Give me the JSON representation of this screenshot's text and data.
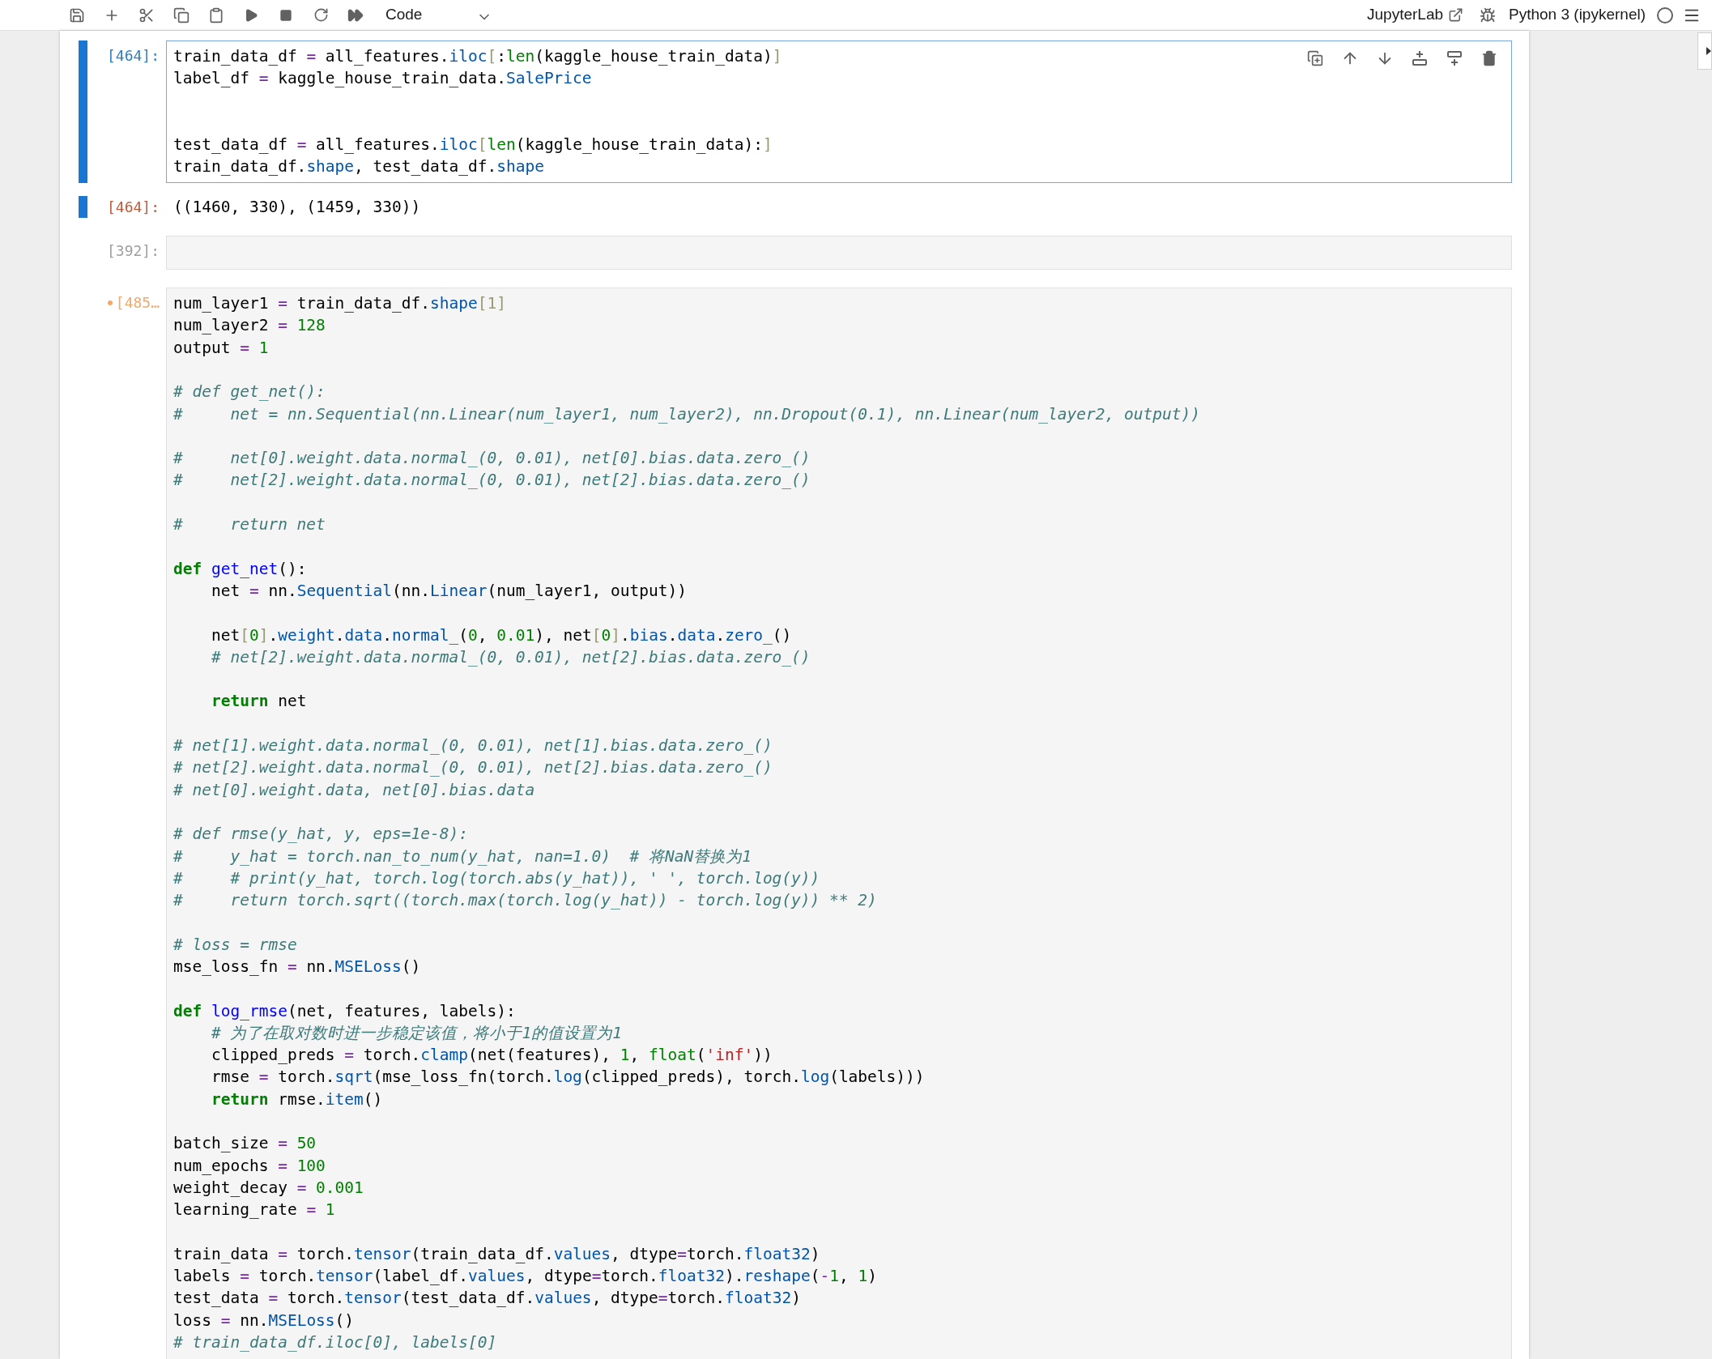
{
  "toolbar": {
    "cell_type": "Code",
    "jupyterlab_link": "JupyterLab",
    "kernel": "Python 3 (ipykernel)",
    "kernel_busy": false
  },
  "cells": [
    {
      "prompt": "[464]:",
      "selected": true,
      "dirty": false,
      "lines": [
        {
          "kind": "code",
          "segments": [
            {
              "kind": "name",
              "text": "train_data_df "
            },
            {
              "kind": "op",
              "text": "="
            },
            {
              "kind": "name",
              "text": " all_features."
            },
            {
              "kind": "attr",
              "text": "iloc"
            },
            {
              "kind": "bracket",
              "text": "["
            },
            {
              "kind": "name",
              "text": ":"
            },
            {
              "kind": "builtin",
              "text": "len"
            },
            {
              "kind": "name",
              "text": "(kaggle_house_train_data)"
            },
            {
              "kind": "bracket",
              "text": "]"
            }
          ]
        },
        {
          "kind": "code",
          "segments": [
            {
              "kind": "name",
              "text": "label_df "
            },
            {
              "kind": "op",
              "text": "="
            },
            {
              "kind": "name",
              "text": " kaggle_house_train_data."
            },
            {
              "kind": "attr",
              "text": "SalePrice"
            }
          ]
        },
        {
          "kind": "blank"
        },
        {
          "kind": "blank"
        },
        {
          "kind": "code",
          "segments": [
            {
              "kind": "name",
              "text": "test_data_df "
            },
            {
              "kind": "op",
              "text": "="
            },
            {
              "kind": "name",
              "text": " all_features."
            },
            {
              "kind": "attr",
              "text": "iloc"
            },
            {
              "kind": "bracket",
              "text": "["
            },
            {
              "kind": "builtin",
              "text": "len"
            },
            {
              "kind": "name",
              "text": "(kaggle_house_train_data):"
            },
            {
              "kind": "bracket",
              "text": "]"
            }
          ]
        },
        {
          "kind": "code",
          "segments": [
            {
              "kind": "name",
              "text": "train_data_df."
            },
            {
              "kind": "attr",
              "text": "shape"
            },
            {
              "kind": "name",
              "text": ", test_data_df."
            },
            {
              "kind": "attr",
              "text": "shape"
            }
          ]
        }
      ],
      "output": {
        "prompt": "[464]:",
        "text": "((1460, 330), (1459, 330))"
      }
    },
    {
      "prompt": "[392]:",
      "selected": false,
      "dirty": false
    },
    {
      "prompt": "[485…",
      "selected": false,
      "dirty": true,
      "lines": [
        {
          "kind": "code",
          "segments": [
            {
              "kind": "name",
              "text": "num_layer1 "
            },
            {
              "kind": "op",
              "text": "="
            },
            {
              "kind": "name",
              "text": " train_data_df."
            },
            {
              "kind": "attr",
              "text": "shape"
            },
            {
              "kind": "bracket",
              "text": "[1]"
            }
          ]
        },
        {
          "kind": "code",
          "segments": [
            {
              "kind": "name",
              "text": "num_layer2 "
            },
            {
              "kind": "op",
              "text": "="
            },
            {
              "kind": "num",
              "text": " 128"
            }
          ]
        },
        {
          "kind": "code",
          "segments": [
            {
              "kind": "name",
              "text": "output "
            },
            {
              "kind": "op",
              "text": "="
            },
            {
              "kind": "num",
              "text": " 1"
            }
          ]
        },
        {
          "kind": "blank"
        },
        {
          "kind": "code",
          "segments": [
            {
              "kind": "comment",
              "text": "# def get_net():"
            }
          ]
        },
        {
          "kind": "code",
          "segments": [
            {
              "kind": "comment",
              "text": "#     net = nn.Sequential(nn.Linear(num_layer1, num_layer2), nn.Dropout(0.1), nn.Linear(num_layer2, output))"
            }
          ]
        },
        {
          "kind": "blank"
        },
        {
          "kind": "code",
          "segments": [
            {
              "kind": "comment",
              "text": "#     net[0].weight.data.normal_(0, 0.01), net[0].bias.data.zero_()"
            }
          ]
        },
        {
          "kind": "code",
          "segments": [
            {
              "kind": "comment",
              "text": "#     net[2].weight.data.normal_(0, 0.01), net[2].bias.data.zero_()"
            }
          ]
        },
        {
          "kind": "blank"
        },
        {
          "kind": "code",
          "segments": [
            {
              "kind": "comment",
              "text": "#     return net"
            }
          ]
        },
        {
          "kind": "blank"
        },
        {
          "kind": "code",
          "segments": [
            {
              "kind": "kw",
              "text": "def"
            },
            {
              "kind": "def",
              "text": " get_net"
            },
            {
              "kind": "name",
              "text": "():"
            }
          ]
        },
        {
          "kind": "code",
          "segments": [
            {
              "kind": "name",
              "text": "    net "
            },
            {
              "kind": "op",
              "text": "="
            },
            {
              "kind": "name",
              "text": " nn."
            },
            {
              "kind": "attr",
              "text": "Sequential"
            },
            {
              "kind": "name",
              "text": "(nn."
            },
            {
              "kind": "attr",
              "text": "Linear"
            },
            {
              "kind": "name",
              "text": "(num_layer1, output))"
            }
          ]
        },
        {
          "kind": "blank"
        },
        {
          "kind": "code",
          "segments": [
            {
              "kind": "name",
              "text": "    net"
            },
            {
              "kind": "bracket",
              "text": "["
            },
            {
              "kind": "num",
              "text": "0"
            },
            {
              "kind": "bracket",
              "text": "]"
            },
            {
              "kind": "name",
              "text": "."
            },
            {
              "kind": "attr",
              "text": "weight"
            },
            {
              "kind": "name",
              "text": "."
            },
            {
              "kind": "attr",
              "text": "data"
            },
            {
              "kind": "name",
              "text": "."
            },
            {
              "kind": "attr",
              "text": "normal_"
            },
            {
              "kind": "name",
              "text": "("
            },
            {
              "kind": "num",
              "text": "0"
            },
            {
              "kind": "name",
              "text": ", "
            },
            {
              "kind": "num",
              "text": "0.01"
            },
            {
              "kind": "name",
              "text": "), net"
            },
            {
              "kind": "bracket",
              "text": "["
            },
            {
              "kind": "num",
              "text": "0"
            },
            {
              "kind": "bracket",
              "text": "]"
            },
            {
              "kind": "name",
              "text": "."
            },
            {
              "kind": "attr",
              "text": "bias"
            },
            {
              "kind": "name",
              "text": "."
            },
            {
              "kind": "attr",
              "text": "data"
            },
            {
              "kind": "name",
              "text": "."
            },
            {
              "kind": "attr",
              "text": "zero_"
            },
            {
              "kind": "name",
              "text": "()"
            }
          ]
        },
        {
          "kind": "code",
          "segments": [
            {
              "kind": "comment",
              "text": "    # net[2].weight.data.normal_(0, 0.01), net[2].bias.data.zero_()"
            }
          ]
        },
        {
          "kind": "blank"
        },
        {
          "kind": "code",
          "segments": [
            {
              "kind": "kw",
              "text": "    return"
            },
            {
              "kind": "name",
              "text": " net"
            }
          ]
        },
        {
          "kind": "blank"
        },
        {
          "kind": "code",
          "segments": [
            {
              "kind": "comment",
              "text": "# net[1].weight.data.normal_(0, 0.01), net[1].bias.data.zero_()"
            }
          ]
        },
        {
          "kind": "code",
          "segments": [
            {
              "kind": "comment",
              "text": "# net[2].weight.data.normal_(0, 0.01), net[2].bias.data.zero_()"
            }
          ]
        },
        {
          "kind": "code",
          "segments": [
            {
              "kind": "comment",
              "text": "# net[0].weight.data, net[0].bias.data"
            }
          ]
        },
        {
          "kind": "blank"
        },
        {
          "kind": "code",
          "segments": [
            {
              "kind": "comment",
              "text": "# def rmse(y_hat, y, eps=1e-8):"
            }
          ]
        },
        {
          "kind": "code",
          "segments": [
            {
              "kind": "comment",
              "text": "#     y_hat = torch.nan_to_num(y_hat, nan=1.0)  # 将NaN替换为1"
            }
          ]
        },
        {
          "kind": "code",
          "segments": [
            {
              "kind": "comment",
              "text": "#     # print(y_hat, torch.log(torch.abs(y_hat)), ' ', torch.log(y))"
            }
          ]
        },
        {
          "kind": "code",
          "segments": [
            {
              "kind": "comment",
              "text": "#     return torch.sqrt((torch.max(torch.log(y_hat)) - torch.log(y)) ** 2)"
            }
          ]
        },
        {
          "kind": "blank"
        },
        {
          "kind": "code",
          "segments": [
            {
              "kind": "comment",
              "text": "# loss = rmse"
            }
          ]
        },
        {
          "kind": "code",
          "segments": [
            {
              "kind": "name",
              "text": "mse_loss_fn "
            },
            {
              "kind": "op",
              "text": "="
            },
            {
              "kind": "name",
              "text": " nn."
            },
            {
              "kind": "attr",
              "text": "MSELoss"
            },
            {
              "kind": "name",
              "text": "()"
            }
          ]
        },
        {
          "kind": "blank"
        },
        {
          "kind": "code",
          "segments": [
            {
              "kind": "kw",
              "text": "def"
            },
            {
              "kind": "def",
              "text": " log_rmse"
            },
            {
              "kind": "name",
              "text": "(net, features, labels):"
            }
          ]
        },
        {
          "kind": "code",
          "segments": [
            {
              "kind": "comment",
              "text": "    # 为了在取对数时进一步稳定该值，将小于1的值设置为1"
            }
          ]
        },
        {
          "kind": "code",
          "segments": [
            {
              "kind": "name",
              "text": "    clipped_preds "
            },
            {
              "kind": "op",
              "text": "="
            },
            {
              "kind": "name",
              "text": " torch."
            },
            {
              "kind": "attr",
              "text": "clamp"
            },
            {
              "kind": "name",
              "text": "(net(features), "
            },
            {
              "kind": "num",
              "text": "1"
            },
            {
              "kind": "name",
              "text": ", "
            },
            {
              "kind": "builtin",
              "text": "float"
            },
            {
              "kind": "name",
              "text": "("
            },
            {
              "kind": "str",
              "text": "'inf'"
            },
            {
              "kind": "name",
              "text": "))"
            }
          ]
        },
        {
          "kind": "code",
          "segments": [
            {
              "kind": "name",
              "text": "    rmse "
            },
            {
              "kind": "op",
              "text": "="
            },
            {
              "kind": "name",
              "text": " torch."
            },
            {
              "kind": "attr",
              "text": "sqrt"
            },
            {
              "kind": "name",
              "text": "(mse_loss_fn(torch."
            },
            {
              "kind": "attr",
              "text": "log"
            },
            {
              "kind": "name",
              "text": "(clipped_preds), torch."
            },
            {
              "kind": "attr",
              "text": "log"
            },
            {
              "kind": "name",
              "text": "(labels)))"
            }
          ]
        },
        {
          "kind": "code",
          "segments": [
            {
              "kind": "kw",
              "text": "    return"
            },
            {
              "kind": "name",
              "text": " rmse."
            },
            {
              "kind": "attr",
              "text": "item"
            },
            {
              "kind": "name",
              "text": "()"
            }
          ]
        },
        {
          "kind": "blank"
        },
        {
          "kind": "code",
          "segments": [
            {
              "kind": "name",
              "text": "batch_size "
            },
            {
              "kind": "op",
              "text": "="
            },
            {
              "kind": "num",
              "text": " 50"
            }
          ]
        },
        {
          "kind": "code",
          "segments": [
            {
              "kind": "name",
              "text": "num_epochs "
            },
            {
              "kind": "op",
              "text": "="
            },
            {
              "kind": "num",
              "text": " 100"
            }
          ]
        },
        {
          "kind": "code",
          "segments": [
            {
              "kind": "name",
              "text": "weight_decay "
            },
            {
              "kind": "op",
              "text": "="
            },
            {
              "kind": "num",
              "text": " 0.001"
            }
          ]
        },
        {
          "kind": "code",
          "segments": [
            {
              "kind": "name",
              "text": "learning_rate "
            },
            {
              "kind": "op",
              "text": "="
            },
            {
              "kind": "num",
              "text": " 1"
            }
          ]
        },
        {
          "kind": "blank"
        },
        {
          "kind": "code",
          "segments": [
            {
              "kind": "name",
              "text": "train_data "
            },
            {
              "kind": "op",
              "text": "="
            },
            {
              "kind": "name",
              "text": " torch."
            },
            {
              "kind": "attr",
              "text": "tensor"
            },
            {
              "kind": "name",
              "text": "(train_data_df."
            },
            {
              "kind": "attr",
              "text": "values"
            },
            {
              "kind": "name",
              "text": ", dtype"
            },
            {
              "kind": "op",
              "text": "="
            },
            {
              "kind": "name",
              "text": "torch."
            },
            {
              "kind": "attr",
              "text": "float32"
            },
            {
              "kind": "name",
              "text": ")"
            }
          ]
        },
        {
          "kind": "code",
          "segments": [
            {
              "kind": "name",
              "text": "labels "
            },
            {
              "kind": "op",
              "text": "="
            },
            {
              "kind": "name",
              "text": " torch."
            },
            {
              "kind": "attr",
              "text": "tensor"
            },
            {
              "kind": "name",
              "text": "(label_df."
            },
            {
              "kind": "attr",
              "text": "values"
            },
            {
              "kind": "name",
              "text": ", dtype"
            },
            {
              "kind": "op",
              "text": "="
            },
            {
              "kind": "name",
              "text": "torch."
            },
            {
              "kind": "attr",
              "text": "float32"
            },
            {
              "kind": "name",
              "text": ")."
            },
            {
              "kind": "attr",
              "text": "reshape"
            },
            {
              "kind": "name",
              "text": "("
            },
            {
              "kind": "op",
              "text": "-"
            },
            {
              "kind": "num",
              "text": "1"
            },
            {
              "kind": "name",
              "text": ", "
            },
            {
              "kind": "num",
              "text": "1"
            },
            {
              "kind": "name",
              "text": ")"
            }
          ]
        },
        {
          "kind": "code",
          "segments": [
            {
              "kind": "name",
              "text": "test_data "
            },
            {
              "kind": "op",
              "text": "="
            },
            {
              "kind": "name",
              "text": " torch."
            },
            {
              "kind": "attr",
              "text": "tensor"
            },
            {
              "kind": "name",
              "text": "(test_data_df."
            },
            {
              "kind": "attr",
              "text": "values"
            },
            {
              "kind": "name",
              "text": ", dtype"
            },
            {
              "kind": "op",
              "text": "="
            },
            {
              "kind": "name",
              "text": "torch."
            },
            {
              "kind": "attr",
              "text": "float32"
            },
            {
              "kind": "name",
              "text": ")"
            }
          ]
        },
        {
          "kind": "code",
          "segments": [
            {
              "kind": "name",
              "text": "loss "
            },
            {
              "kind": "op",
              "text": "="
            },
            {
              "kind": "name",
              "text": " nn."
            },
            {
              "kind": "attr",
              "text": "MSELoss"
            },
            {
              "kind": "name",
              "text": "()"
            }
          ]
        },
        {
          "kind": "code",
          "segments": [
            {
              "kind": "comment",
              "text": "# train_data_df.iloc[0], labels[0]"
            }
          ]
        }
      ]
    }
  ]
}
